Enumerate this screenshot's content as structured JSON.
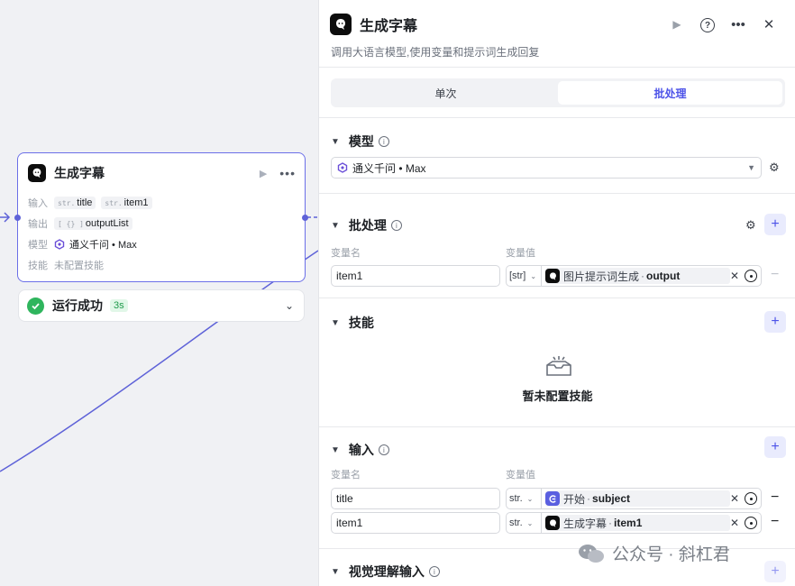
{
  "node": {
    "title": "生成字幕",
    "input_label": "输入",
    "inputs": [
      {
        "type": "str.",
        "name": "title"
      },
      {
        "type": "str.",
        "name": "item1"
      }
    ],
    "output_label": "输出",
    "outputs": [
      {
        "type": "[ {} ]",
        "name": "outputList"
      }
    ],
    "model_label": "模型",
    "model_value": "通义千问 • Max",
    "skill_label": "技能",
    "skill_value": "未配置技能"
  },
  "run": {
    "status": "运行成功",
    "time": "3s"
  },
  "panel": {
    "title": "生成字幕",
    "description": "调用大语言模型,使用变量和提示词生成回复",
    "tabs": [
      {
        "label": "单次",
        "active": false
      },
      {
        "label": "批处理",
        "active": true
      }
    ],
    "model": {
      "section": "模型",
      "value": "通义千问 • Max"
    },
    "batch": {
      "section": "批处理",
      "col_name": "变量名",
      "col_value": "变量值",
      "rows": [
        {
          "name": "item1",
          "type": "[str]",
          "source": "图片提示词生成",
          "var": "output"
        }
      ]
    },
    "skills": {
      "section": "技能",
      "empty": "暂未配置技能"
    },
    "inputs": {
      "section": "输入",
      "col_name": "变量名",
      "col_value": "变量值",
      "rows": [
        {
          "name": "title",
          "type": "str.",
          "source": "开始",
          "var": "subject"
        },
        {
          "name": "item1",
          "type": "str.",
          "source": "生成字幕",
          "var": "item1"
        }
      ]
    },
    "vision": {
      "section": "视觉理解输入"
    }
  },
  "watermark": "公众号 · 斜杠君",
  "colors": {
    "accent": "#4d53e8",
    "edge": "#5e62d8",
    "success": "#2fb55d"
  }
}
